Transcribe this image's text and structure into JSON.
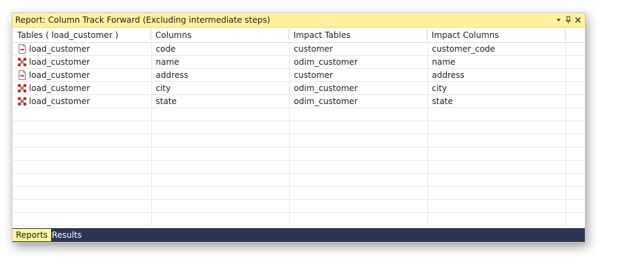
{
  "window": {
    "title": "Report: Column Track Forward (Excluding intermediate steps)"
  },
  "grid": {
    "columns": [
      "Tables ( load_customer )",
      "Columns",
      "Impact Tables",
      "Impact Columns"
    ],
    "rows": [
      {
        "icon": "load-table-icon",
        "table": "load_customer",
        "column": "code",
        "impact_table": "customer",
        "impact_column": "customer_code"
      },
      {
        "icon": "transform-table-icon",
        "table": "load_customer",
        "column": "name",
        "impact_table": "odim_customer",
        "impact_column": "name"
      },
      {
        "icon": "load-table-icon",
        "table": "load_customer",
        "column": "address",
        "impact_table": "customer",
        "impact_column": "address"
      },
      {
        "icon": "transform-table-icon",
        "table": "load_customer",
        "column": "city",
        "impact_table": "odim_customer",
        "impact_column": "city"
      },
      {
        "icon": "transform-table-icon",
        "table": "load_customer",
        "column": "state",
        "impact_table": "odim_customer",
        "impact_column": "state"
      }
    ]
  },
  "tabs": [
    "Reports",
    "Results"
  ],
  "colors": {
    "title_bg": "#fff29d",
    "tabbar_bg": "#2b3752",
    "active_tab_bg": "#fff29d"
  }
}
